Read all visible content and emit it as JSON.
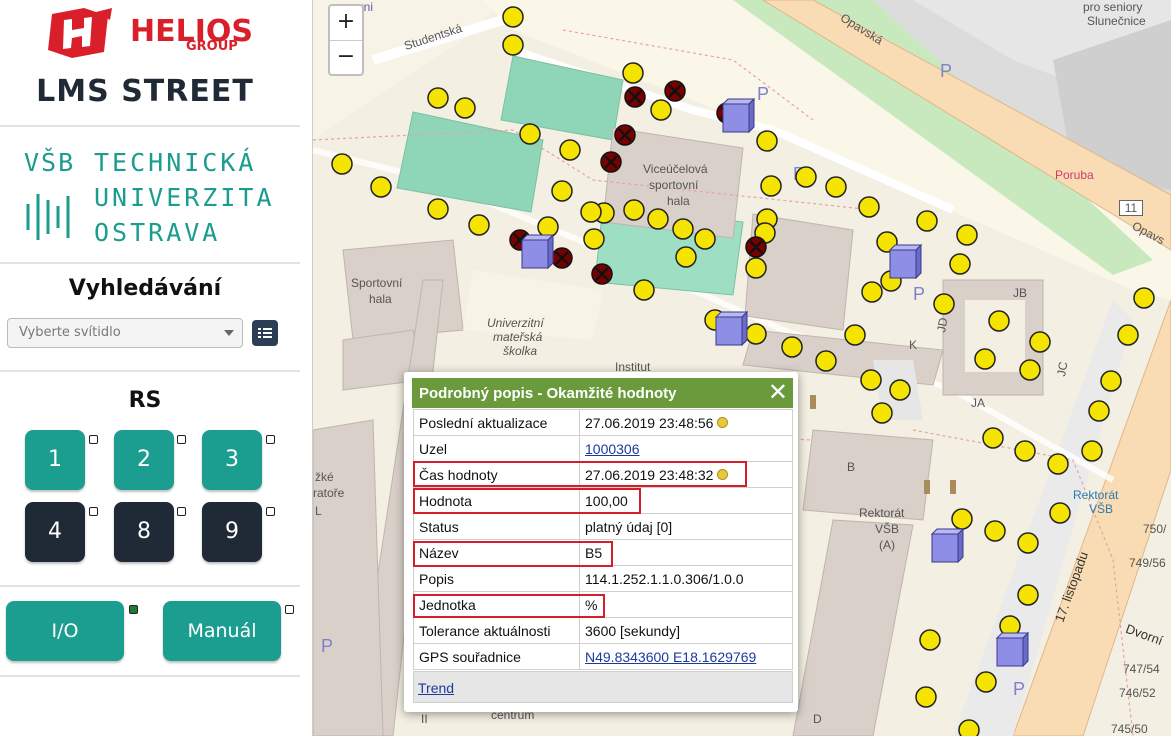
{
  "brand": {
    "name": "HELIOS",
    "group": "GROUP",
    "app_title": "LMS STREET"
  },
  "university": {
    "abbr": "VŠB",
    "line1": "TECHNICKÁ",
    "line2": "UNIVERZITA",
    "line3": "OSTRAVA"
  },
  "search": {
    "title": "Vyhledávání",
    "placeholder": "Vyberte svítidlo"
  },
  "rs": {
    "title": "RS",
    "buttons": [
      "1",
      "2",
      "3",
      "4",
      "8",
      "9"
    ]
  },
  "controls": {
    "io_label": "I/O",
    "manual_label": "Manuál",
    "io_indicator_on": true
  },
  "map": {
    "zoom_in": "+",
    "zoom_out": "−",
    "labels": {
      "studentska": "Studentská",
      "pro_seniory": "pro seniory",
      "slunecnice": "Slunečnice",
      "opavska": "Opavská",
      "poruba": "Poruba",
      "route": "11",
      "opavs": "Opavs",
      "viceucelova": "Viceúčelová",
      "sportovni": "sportovní",
      "hala": "hala",
      "sportovni_hala_1": "Sportovní",
      "sportovni_hala_2": "hala",
      "ms1": "Univerzitní",
      "ms2": "mateřská",
      "ms3": "školka",
      "institut": "Institut",
      "jb": "JB",
      "jc": "JC",
      "jd": "JD",
      "ja": "JA",
      "k": "K",
      "b": "B",
      "rektorat1": "Rektorát",
      "rektorat2": "VŠB",
      "rektorat3": "(A)",
      "bus1": "Rektorát",
      "bus2": "VŠB",
      "listopadu": "17. listopadu",
      "dvorni": "Dvorní",
      "ske": "žké",
      "atore": "ratoře",
      "arni": "arni",
      "n750": "750/",
      "n749": "749/56",
      "n747": "747/54",
      "n746": "746/52",
      "n745": "745/50",
      "centrum": "centrum",
      "d": "D",
      "i": "II",
      "l": "L"
    }
  },
  "popup": {
    "title": "Podrobný popis - Okamžité hodnoty",
    "close": "✕",
    "rows": [
      {
        "key": "Poslední aktualizace",
        "value": "27.06.2019 23:48:56"
      },
      {
        "key": "Uzel",
        "value": "1000306"
      },
      {
        "key": "Čas hodnoty",
        "value": "27.06.2019 23:48:32"
      },
      {
        "key": "Hodnota",
        "value": "100,00"
      },
      {
        "key": "Status",
        "value": "platný údaj [0]"
      },
      {
        "key": "Název",
        "value": "B5"
      },
      {
        "key": "Popis",
        "value": "114.1.252.1.1.0.306/1.0.0"
      },
      {
        "key": "Jednotka",
        "value": "%"
      },
      {
        "key": "Tolerance aktuálnosti",
        "value": "3600 [sekundy]"
      },
      {
        "key": "GPS souřadnice",
        "value": "N49.8343600 E18.1629769"
      }
    ],
    "footer_link": "Trend"
  },
  "colors": {
    "teal": "#1b9e8f",
    "dark": "#1f2a36",
    "accent_red": "#d9202a",
    "popup_header": "#6a9a3c",
    "lamp": "#f5e400"
  }
}
